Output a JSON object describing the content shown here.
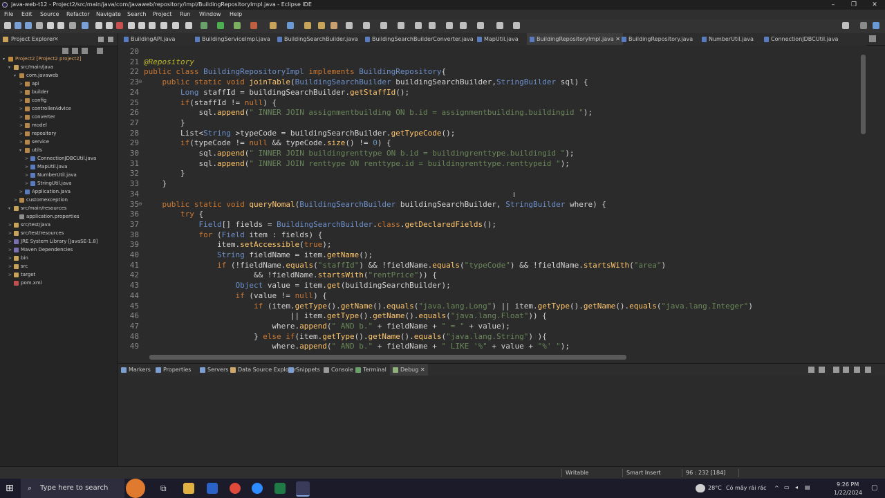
{
  "window": {
    "title": "java-web-t12 - Project2/src/main/java/com/javaweb/repository/impl/BuildingRepositoryImpl.java - Eclipse IDE"
  },
  "menu": [
    "File",
    "Edit",
    "Source",
    "Refactor",
    "Navigate",
    "Search",
    "Project",
    "Run",
    "Window",
    "Help"
  ],
  "explorer": {
    "title": "Project Explorer",
    "items": [
      {
        "label": "Project2 [Project2 project2]",
        "depth": 0,
        "arrow": "▾",
        "color": "#c08a3e"
      },
      {
        "label": "src/main/java",
        "depth": 1,
        "arrow": "▾",
        "color": "#c8a35a"
      },
      {
        "label": "com.javaweb",
        "depth": 2,
        "arrow": "▾",
        "color": "#b5884a"
      },
      {
        "label": "api",
        "depth": 3,
        "arrow": ">",
        "color": "#b5884a"
      },
      {
        "label": "builder",
        "depth": 3,
        "arrow": ">",
        "color": "#b5884a"
      },
      {
        "label": "config",
        "depth": 3,
        "arrow": ">",
        "color": "#b5884a"
      },
      {
        "label": "controllerAdvice",
        "depth": 3,
        "arrow": ">",
        "color": "#b5884a"
      },
      {
        "label": "converter",
        "depth": 3,
        "arrow": ">",
        "color": "#b5884a"
      },
      {
        "label": "model",
        "depth": 3,
        "arrow": ">",
        "color": "#b5884a"
      },
      {
        "label": "repository",
        "depth": 3,
        "arrow": ">",
        "color": "#b5884a"
      },
      {
        "label": "service",
        "depth": 3,
        "arrow": ">",
        "color": "#b5884a"
      },
      {
        "label": "utils",
        "depth": 3,
        "arrow": "▾",
        "color": "#b5884a"
      },
      {
        "label": "ConnectionJDBCUtil.java",
        "depth": 4,
        "arrow": ">",
        "color": "#5a7bbd"
      },
      {
        "label": "MapUtil.java",
        "depth": 4,
        "arrow": ">",
        "color": "#5a7bbd"
      },
      {
        "label": "NumberUtil.java",
        "depth": 4,
        "arrow": ">",
        "color": "#5a7bbd"
      },
      {
        "label": "StringUtil.java",
        "depth": 4,
        "arrow": ">",
        "color": "#5a7bbd"
      },
      {
        "label": "Application.java",
        "depth": 3,
        "arrow": ">",
        "color": "#5a7bbd"
      },
      {
        "label": "customexception",
        "depth": 2,
        "arrow": ">",
        "color": "#b5884a"
      },
      {
        "label": "src/main/resources",
        "depth": 1,
        "arrow": "▾",
        "color": "#c8a35a"
      },
      {
        "label": "application.properties",
        "depth": 2,
        "arrow": "",
        "color": "#8f8f8f"
      },
      {
        "label": "src/test/java",
        "depth": 1,
        "arrow": ">",
        "color": "#c8a35a"
      },
      {
        "label": "src/test/resources",
        "depth": 1,
        "arrow": ">",
        "color": "#c8a35a"
      },
      {
        "label": "JRE System Library [JavaSE-1.8]",
        "depth": 1,
        "arrow": ">",
        "color": "#7a6fb0"
      },
      {
        "label": "Maven Dependencies",
        "depth": 1,
        "arrow": ">",
        "color": "#7a6fb0"
      },
      {
        "label": "bin",
        "depth": 1,
        "arrow": ">",
        "color": "#c8a35a"
      },
      {
        "label": "src",
        "depth": 1,
        "arrow": ">",
        "color": "#c8a35a"
      },
      {
        "label": "target",
        "depth": 1,
        "arrow": ">",
        "color": "#c8a35a"
      },
      {
        "label": "pom.xml",
        "depth": 1,
        "arrow": "",
        "color": "#c05050"
      }
    ]
  },
  "tabs": [
    {
      "label": "BuildingAPI.java",
      "active": false
    },
    {
      "label": "BuildingServiceImpl.java",
      "active": false
    },
    {
      "label": "BuildingSearchBuilder.java",
      "active": false
    },
    {
      "label": "BuildingSearchBuilderConverter.java",
      "active": false
    },
    {
      "label": "MapUtil.java",
      "active": false
    },
    {
      "label": "BuildingRepositoryImpl.java",
      "active": true
    },
    {
      "label": "BuildingRepository.java",
      "active": false
    },
    {
      "label": "NumberUtil.java",
      "active": false
    },
    {
      "label": "ConnectionJDBCUtil.java",
      "active": false
    }
  ],
  "code": {
    "lines": [
      {
        "n": "20",
        "tokens": []
      },
      {
        "n": "21",
        "tokens": [
          [
            "ann",
            "@Repository"
          ]
        ]
      },
      {
        "n": "22",
        "tokens": [
          [
            "kw",
            "public class "
          ],
          [
            "ty",
            "BuildingRepositoryImpl "
          ],
          [
            "kw",
            "implements "
          ],
          [
            "ty",
            "BuildingRepository"
          ],
          [
            "vr",
            "{"
          ]
        ]
      },
      {
        "n": "23",
        "fold": true,
        "tokens": [
          [
            "vr",
            "    "
          ],
          [
            "kw",
            "public static void "
          ],
          [
            "mt",
            "joinTable"
          ],
          [
            "vr",
            "("
          ],
          [
            "ty",
            "BuildingSearchBuilder "
          ],
          [
            "vr",
            "buildingSearchBuilder,"
          ],
          [
            "ty",
            "StringBuilder "
          ],
          [
            "vr",
            "sql) {"
          ]
        ]
      },
      {
        "n": "24",
        "tokens": [
          [
            "vr",
            "        "
          ],
          [
            "ty",
            "Long "
          ],
          [
            "vr",
            "staffId = buildingSearchBuilder."
          ],
          [
            "mt",
            "getStaffId"
          ],
          [
            "vr",
            "();"
          ]
        ]
      },
      {
        "n": "25",
        "tokens": [
          [
            "vr",
            "        "
          ],
          [
            "kw",
            "if"
          ],
          [
            "vr",
            "(staffId != "
          ],
          [
            "kw",
            "null"
          ],
          [
            "vr",
            ") {"
          ]
        ]
      },
      {
        "n": "26",
        "tokens": [
          [
            "vr",
            "            sql."
          ],
          [
            "mt",
            "append"
          ],
          [
            "vr",
            "("
          ],
          [
            "str",
            "\" INNER JOIN assignmentbuilding ON b.id = assignmentbuilding.buildingid \""
          ],
          [
            "vr",
            ");"
          ]
        ]
      },
      {
        "n": "27",
        "tokens": [
          [
            "vr",
            "        }"
          ]
        ]
      },
      {
        "n": "28",
        "tokens": [
          [
            "vr",
            "        List<"
          ],
          [
            "ty",
            "String "
          ],
          [
            "vr",
            ">typeCode = buildingSearchBuilder."
          ],
          [
            "mt",
            "getTypeCode"
          ],
          [
            "vr",
            "();"
          ]
        ]
      },
      {
        "n": "29",
        "tokens": [
          [
            "vr",
            "        "
          ],
          [
            "kw",
            "if"
          ],
          [
            "vr",
            "(typeCode != "
          ],
          [
            "kw",
            "null "
          ],
          [
            "vr",
            "&& typeCode."
          ],
          [
            "mt",
            "size"
          ],
          [
            "vr",
            "() != "
          ],
          [
            "num",
            "0"
          ],
          [
            "vr",
            ") {"
          ]
        ]
      },
      {
        "n": "30",
        "tokens": [
          [
            "vr",
            "            sql."
          ],
          [
            "mt",
            "append"
          ],
          [
            "vr",
            "("
          ],
          [
            "str",
            "\" INNER JOIN buildingrenttype ON b.id = buildingrenttype.buildingid \""
          ],
          [
            "vr",
            ");"
          ]
        ]
      },
      {
        "n": "31",
        "tokens": [
          [
            "vr",
            "            sql."
          ],
          [
            "mt",
            "append"
          ],
          [
            "vr",
            "("
          ],
          [
            "str",
            "\" INNER JOIN renttype ON renttype.id = buildingrenttype.renttypeid \""
          ],
          [
            "vr",
            ");"
          ]
        ]
      },
      {
        "n": "32",
        "tokens": [
          [
            "vr",
            "        }"
          ]
        ]
      },
      {
        "n": "33",
        "tokens": [
          [
            "vr",
            "    }"
          ]
        ]
      },
      {
        "n": "34",
        "tokens": []
      },
      {
        "n": "35",
        "fold": true,
        "tokens": [
          [
            "vr",
            "    "
          ],
          [
            "kw",
            "public static void "
          ],
          [
            "mt",
            "queryNomal"
          ],
          [
            "vr",
            "("
          ],
          [
            "ty",
            "BuildingSearchBuilder "
          ],
          [
            "vr",
            "buildingSearchBuilder, "
          ],
          [
            "ty",
            "StringBuilder "
          ],
          [
            "vr",
            "where) {"
          ]
        ]
      },
      {
        "n": "36",
        "tokens": [
          [
            "vr",
            "        "
          ],
          [
            "kw",
            "try "
          ],
          [
            "vr",
            "{"
          ]
        ]
      },
      {
        "n": "37",
        "tokens": [
          [
            "vr",
            "            "
          ],
          [
            "ty",
            "Field"
          ],
          [
            "vr",
            "[] fields = "
          ],
          [
            "ty",
            "BuildingSearchBuilder"
          ],
          [
            "vr",
            "."
          ],
          [
            "kw",
            "class"
          ],
          [
            "vr",
            "."
          ],
          [
            "mt",
            "getDeclaredFields"
          ],
          [
            "vr",
            "();"
          ]
        ]
      },
      {
        "n": "38",
        "tokens": [
          [
            "vr",
            "            "
          ],
          [
            "kw",
            "for "
          ],
          [
            "vr",
            "("
          ],
          [
            "ty",
            "Field "
          ],
          [
            "vr",
            "item : fields) {"
          ]
        ]
      },
      {
        "n": "39",
        "tokens": [
          [
            "vr",
            "                item."
          ],
          [
            "mt",
            "setAccessible"
          ],
          [
            "vr",
            "("
          ],
          [
            "kw",
            "true"
          ],
          [
            "vr",
            ");"
          ]
        ]
      },
      {
        "n": "40",
        "tokens": [
          [
            "vr",
            "                "
          ],
          [
            "ty",
            "String "
          ],
          [
            "vr",
            "fieldName = item."
          ],
          [
            "mt",
            "getName"
          ],
          [
            "vr",
            "();"
          ]
        ]
      },
      {
        "n": "41",
        "tokens": [
          [
            "vr",
            "                "
          ],
          [
            "kw",
            "if "
          ],
          [
            "vr",
            "(!fieldName."
          ],
          [
            "mt",
            "equals"
          ],
          [
            "vr",
            "("
          ],
          [
            "str",
            "\"staffId\""
          ],
          [
            "vr",
            ") && !fieldName."
          ],
          [
            "mt",
            "equals"
          ],
          [
            "vr",
            "("
          ],
          [
            "str",
            "\"typeCode\""
          ],
          [
            "vr",
            ") && !fieldName."
          ],
          [
            "mt",
            "startsWith"
          ],
          [
            "vr",
            "("
          ],
          [
            "str",
            "\"area\""
          ],
          [
            "vr",
            ")"
          ]
        ]
      },
      {
        "n": "42",
        "tokens": [
          [
            "vr",
            "                        && !fieldName."
          ],
          [
            "mt",
            "startsWith"
          ],
          [
            "vr",
            "("
          ],
          [
            "str",
            "\"rentPrice\""
          ],
          [
            "vr",
            ")) {"
          ]
        ]
      },
      {
        "n": "43",
        "tokens": [
          [
            "vr",
            "                    "
          ],
          [
            "ty",
            "Object "
          ],
          [
            "vr",
            "value = item."
          ],
          [
            "mt",
            "get"
          ],
          [
            "vr",
            "(buildingSearchBuilder);"
          ]
        ]
      },
      {
        "n": "44",
        "tokens": [
          [
            "vr",
            "                    "
          ],
          [
            "kw",
            "if "
          ],
          [
            "vr",
            "(value != "
          ],
          [
            "kw",
            "null"
          ],
          [
            "vr",
            ") {"
          ]
        ]
      },
      {
        "n": "45",
        "tokens": [
          [
            "vr",
            "                        "
          ],
          [
            "kw",
            "if "
          ],
          [
            "vr",
            "(item."
          ],
          [
            "mt",
            "getType"
          ],
          [
            "vr",
            "()."
          ],
          [
            "mt",
            "getName"
          ],
          [
            "vr",
            "()."
          ],
          [
            "mt",
            "equals"
          ],
          [
            "vr",
            "("
          ],
          [
            "str",
            "\"java.lang.Long\""
          ],
          [
            "vr",
            ") || item."
          ],
          [
            "mt",
            "getType"
          ],
          [
            "vr",
            "()."
          ],
          [
            "mt",
            "getName"
          ],
          [
            "vr",
            "()."
          ],
          [
            "mt",
            "equals"
          ],
          [
            "vr",
            "("
          ],
          [
            "str",
            "\"java.lang.Integer\""
          ],
          [
            "vr",
            ")"
          ]
        ]
      },
      {
        "n": "46",
        "tokens": [
          [
            "vr",
            "                                || item."
          ],
          [
            "mt",
            "getType"
          ],
          [
            "vr",
            "()."
          ],
          [
            "mt",
            "getName"
          ],
          [
            "vr",
            "()."
          ],
          [
            "mt",
            "equals"
          ],
          [
            "vr",
            "("
          ],
          [
            "str",
            "\"java.lang.Float\""
          ],
          [
            "vr",
            ")) {"
          ]
        ]
      },
      {
        "n": "47",
        "tokens": [
          [
            "vr",
            "                            where."
          ],
          [
            "mt",
            "append"
          ],
          [
            "vr",
            "("
          ],
          [
            "str",
            "\" AND b.\""
          ],
          [
            "vr",
            " + fieldName + "
          ],
          [
            "str",
            "\" = \""
          ],
          [
            "vr",
            " + value);"
          ]
        ]
      },
      {
        "n": "48",
        "tokens": [
          [
            "vr",
            "                        } "
          ],
          [
            "kw",
            "else if"
          ],
          [
            "vr",
            "(item."
          ],
          [
            "mt",
            "getType"
          ],
          [
            "vr",
            "()."
          ],
          [
            "mt",
            "getName"
          ],
          [
            "vr",
            "()."
          ],
          [
            "mt",
            "equals"
          ],
          [
            "vr",
            "("
          ],
          [
            "str",
            "\"java.lang.String\""
          ],
          [
            "vr",
            ") ){"
          ]
        ]
      },
      {
        "n": "49",
        "tokens": [
          [
            "vr",
            "                            where."
          ],
          [
            "mt",
            "append"
          ],
          [
            "vr",
            "("
          ],
          [
            "str",
            "\" AND b.\""
          ],
          [
            "vr",
            " + fieldName + "
          ],
          [
            "str",
            "\" LIKE '%\""
          ],
          [
            "vr",
            " + value + "
          ],
          [
            "str",
            "\"%' \""
          ],
          [
            "vr",
            ");"
          ]
        ]
      }
    ]
  },
  "bottom_tabs": [
    {
      "label": "Markers",
      "color": "#7a9fd0"
    },
    {
      "label": "Properties",
      "color": "#7a9fd0"
    },
    {
      "label": "Servers",
      "color": "#7a9fd0"
    },
    {
      "label": "Data Source Explorer",
      "color": "#d0a86a"
    },
    {
      "label": "Snippets",
      "color": "#7a9fd0"
    },
    {
      "label": "Console",
      "color": "#9a9a9a"
    },
    {
      "label": "Terminal",
      "color": "#6aa06a"
    },
    {
      "label": "Debug",
      "color": "#8fb27a"
    }
  ],
  "status": {
    "writable": "Writable",
    "insert": "Smart Insert",
    "position": "96 : 232 [184]"
  },
  "taskbar": {
    "search_placeholder": "Type here to search",
    "weather_temp": "28°C",
    "weather_text": "Có mây rải rác",
    "time": "9:26 PM",
    "date": "1/22/2024"
  }
}
